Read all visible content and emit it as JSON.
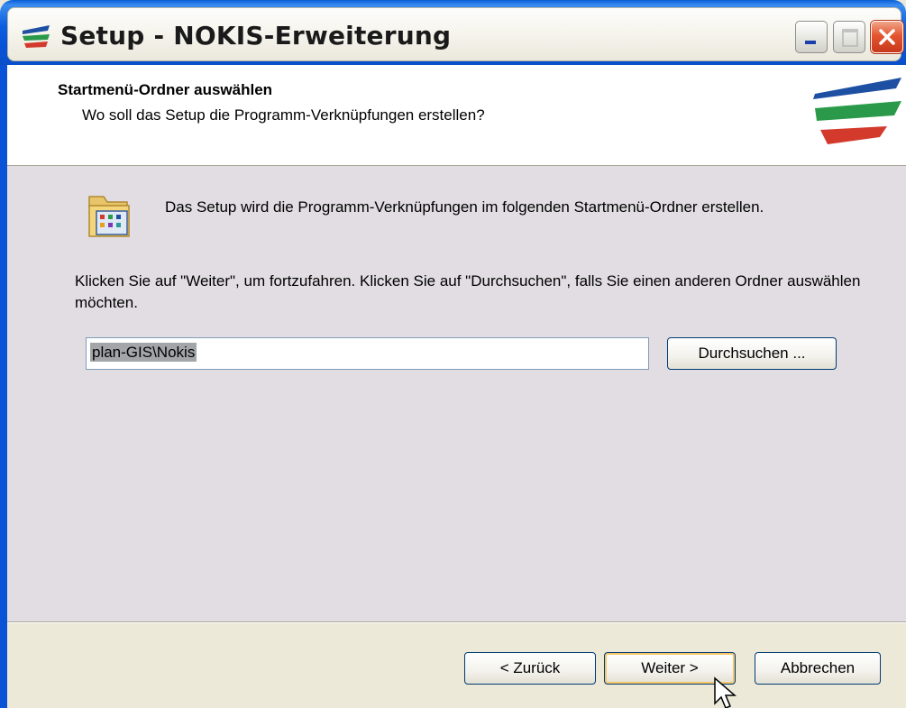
{
  "window": {
    "title": "Setup - NOKIS-Erweiterung"
  },
  "header": {
    "title": "Startmenü-Ordner auswählen",
    "subtitle": "Wo soll das Setup die Programm-Verknüpfungen erstellen?"
  },
  "content": {
    "info_text": "Das Setup wird die Programm-Verknüpfungen im folgenden Startmenü-Ordner erstellen.",
    "instruction_text": "Klicken Sie auf \"Weiter\", um fortzufahren. Klicken Sie auf \"Durchsuchen\", falls Sie einen anderen Ordner auswählen möchten.",
    "folder_value": "plan-GIS\\Nokis",
    "browse_label": "Durchsuchen ..."
  },
  "footer": {
    "back_label": "< Zurück",
    "next_label": "Weiter >",
    "cancel_label": "Abbrechen"
  },
  "icons": {
    "app": "setup-logo-icon",
    "header_logo": "nokis-logo-icon",
    "folder": "programs-folder-icon",
    "cursor": "mouse-pointer-icon"
  },
  "colors": {
    "titlebar": "#0a5ed6",
    "close_button": "#e3562f",
    "content_bg": "#e1dde2",
    "dialog_bg": "#ece9d8"
  }
}
